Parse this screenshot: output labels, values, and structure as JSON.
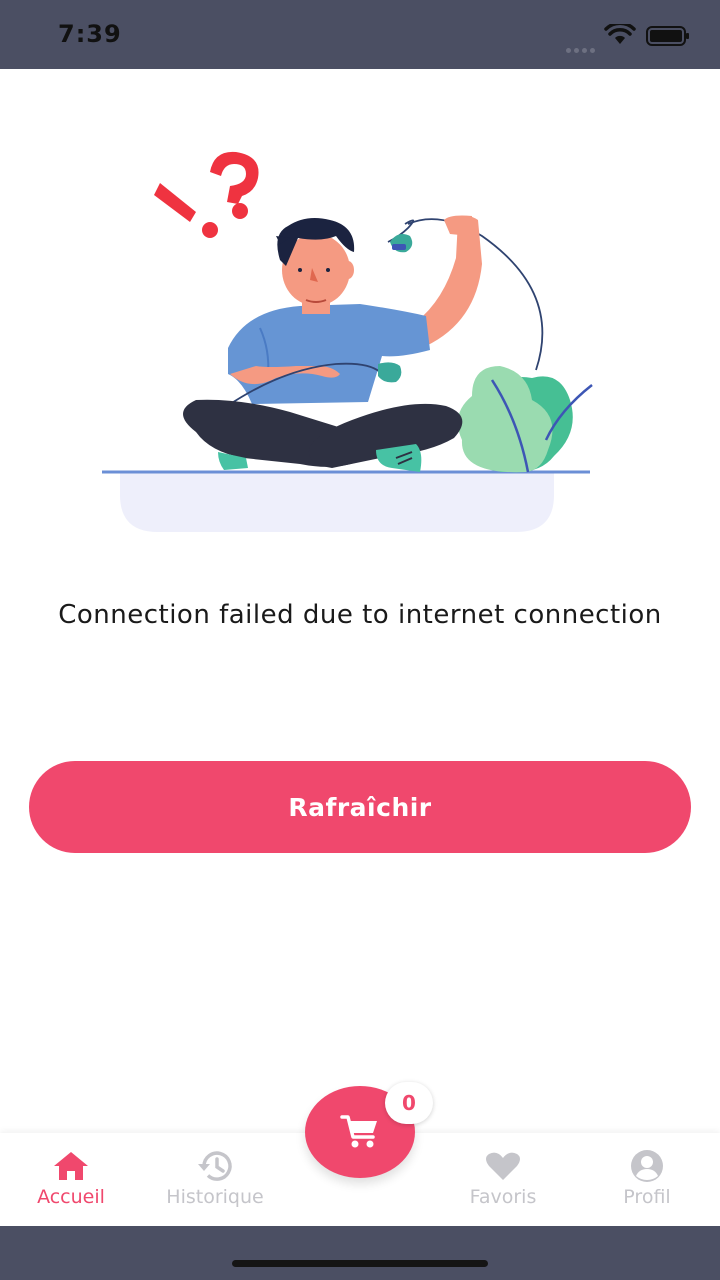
{
  "status_bar": {
    "time": "7:39"
  },
  "main": {
    "message": "Connection failed due to internet connection",
    "refresh_label": "Rafraîchir"
  },
  "tabbar": {
    "tabs": [
      {
        "label": "Accueil",
        "icon": "home-icon",
        "active": true
      },
      {
        "label": "Historique",
        "icon": "history-icon",
        "active": false
      },
      {
        "label": "Favoris",
        "icon": "heart-icon",
        "active": false
      },
      {
        "label": "Profil",
        "icon": "profile-icon",
        "active": false
      }
    ],
    "cart": {
      "icon": "cart-icon",
      "count": "0"
    }
  },
  "colors": {
    "accent": "#f0486d",
    "status_bar": "#4b4f63",
    "inactive_tab": "#c5c5ca"
  }
}
